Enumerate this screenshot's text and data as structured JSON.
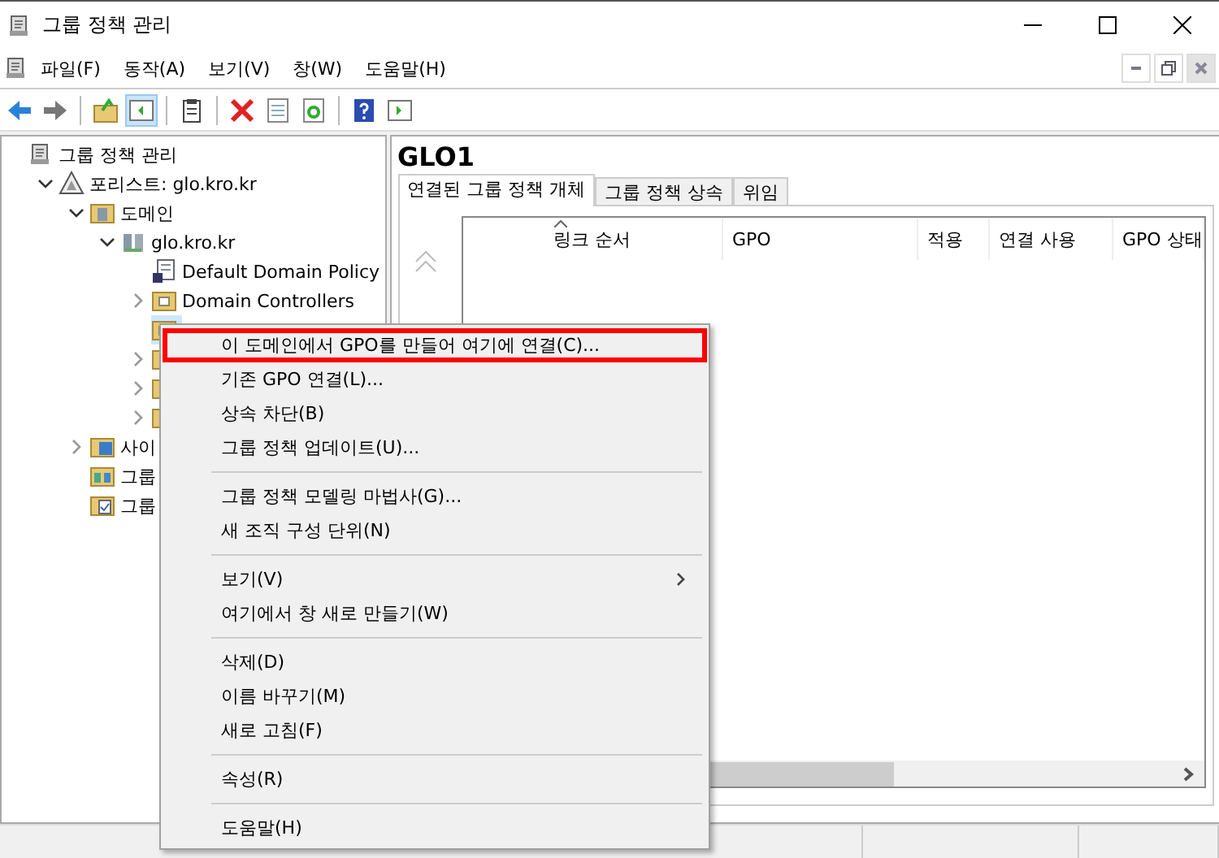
{
  "window": {
    "title": "그룹 정책 관리"
  },
  "menu_bar": [
    "파일(F)",
    "동작(A)",
    "보기(V)",
    "창(W)",
    "도움말(H)"
  ],
  "toolbar": [
    {
      "kind": "back",
      "pressed": false
    },
    {
      "kind": "forward",
      "pressed": false
    },
    {
      "kind": "sep"
    },
    {
      "kind": "up",
      "pressed": false
    },
    {
      "kind": "tree",
      "pressed": true
    },
    {
      "kind": "sep"
    },
    {
      "kind": "clipboard",
      "pressed": false
    },
    {
      "kind": "sep"
    },
    {
      "kind": "delete",
      "pressed": false
    },
    {
      "kind": "properties",
      "pressed": false
    },
    {
      "kind": "refresh",
      "pressed": false
    },
    {
      "kind": "sep"
    },
    {
      "kind": "help",
      "pressed": false
    },
    {
      "kind": "action",
      "pressed": false
    }
  ],
  "tree": [
    {
      "label": "그룹 정책 관리",
      "kind": "scroll",
      "selected": false,
      "children": [
        {
          "label": "포리스트: glo.kro.kr",
          "kind": "forest",
          "expanded": true,
          "selected": false,
          "children": [
            {
              "label": "도메인",
              "kind": "domains",
              "expanded": true,
              "selected": false,
              "children": [
                {
                  "label": "glo.kro.kr",
                  "kind": "domain",
                  "expanded": true,
                  "selected": false,
                  "children": [
                    {
                      "label": "Default Domain Policy",
                      "kind": "gpo",
                      "selected": false
                    },
                    {
                      "label": "Domain Controllers",
                      "kind": "ou",
                      "expanded": false,
                      "selected": false
                    },
                    {
                      "kind": "ou",
                      "selected": true
                    },
                    {
                      "kind": "gpofolder",
                      "expanded": false,
                      "selected": false
                    },
                    {
                      "kind": "filter",
                      "expanded": false,
                      "selected": false
                    },
                    {
                      "kind": "starter",
                      "expanded": false,
                      "selected": false
                    }
                  ]
                }
              ]
            },
            {
              "label": "사이",
              "kind": "sites",
              "expanded": false,
              "selected": false
            },
            {
              "label": "그룹",
              "kind": "modeling",
              "selected": false
            },
            {
              "label": "그룹",
              "kind": "results",
              "selected": false
            }
          ]
        }
      ]
    }
  ],
  "detail": {
    "title": "GLO1",
    "tabs": [
      {
        "label": "연결된 그룹 정책 개체",
        "selected": true
      },
      {
        "label": "그룹 정책 상속",
        "selected": false
      },
      {
        "label": "위임",
        "selected": false
      }
    ],
    "columns": [
      "링크 순서",
      "GPO",
      "적용",
      "연결 사용",
      "GPO 상태"
    ]
  },
  "context_menu": [
    {
      "kind": "item",
      "label": "이 도메인에서 GPO를 만들어 여기에 연결(C)...",
      "highlighted": true,
      "submenu": false
    },
    {
      "kind": "item",
      "label": "기존 GPO 연결(L)...",
      "highlighted": false,
      "submenu": false
    },
    {
      "kind": "item",
      "label": "상속 차단(B)",
      "highlighted": false,
      "submenu": false
    },
    {
      "kind": "item",
      "label": "그룹 정책 업데이트(U)...",
      "highlighted": false,
      "submenu": false
    },
    {
      "kind": "separator"
    },
    {
      "kind": "item",
      "label": "그룹 정책 모델링 마법사(G)...",
      "highlighted": false,
      "submenu": false
    },
    {
      "kind": "item",
      "label": "새 조직 구성 단위(N)",
      "highlighted": false,
      "submenu": false
    },
    {
      "kind": "separator"
    },
    {
      "kind": "item",
      "label": "보기(V)",
      "highlighted": false,
      "submenu": true
    },
    {
      "kind": "item",
      "label": "여기에서 창 새로 만들기(W)",
      "highlighted": false,
      "submenu": false
    },
    {
      "kind": "separator"
    },
    {
      "kind": "item",
      "label": "삭제(D)",
      "highlighted": false,
      "submenu": false
    },
    {
      "kind": "item",
      "label": "이름 바꾸기(M)",
      "highlighted": false,
      "submenu": false
    },
    {
      "kind": "item",
      "label": "새로 고침(F)",
      "highlighted": false,
      "submenu": false
    },
    {
      "kind": "separator"
    },
    {
      "kind": "item",
      "label": "속성(R)",
      "highlighted": false,
      "submenu": false
    },
    {
      "kind": "separator"
    },
    {
      "kind": "item",
      "label": "도움말(H)",
      "highlighted": false,
      "submenu": false
    }
  ]
}
